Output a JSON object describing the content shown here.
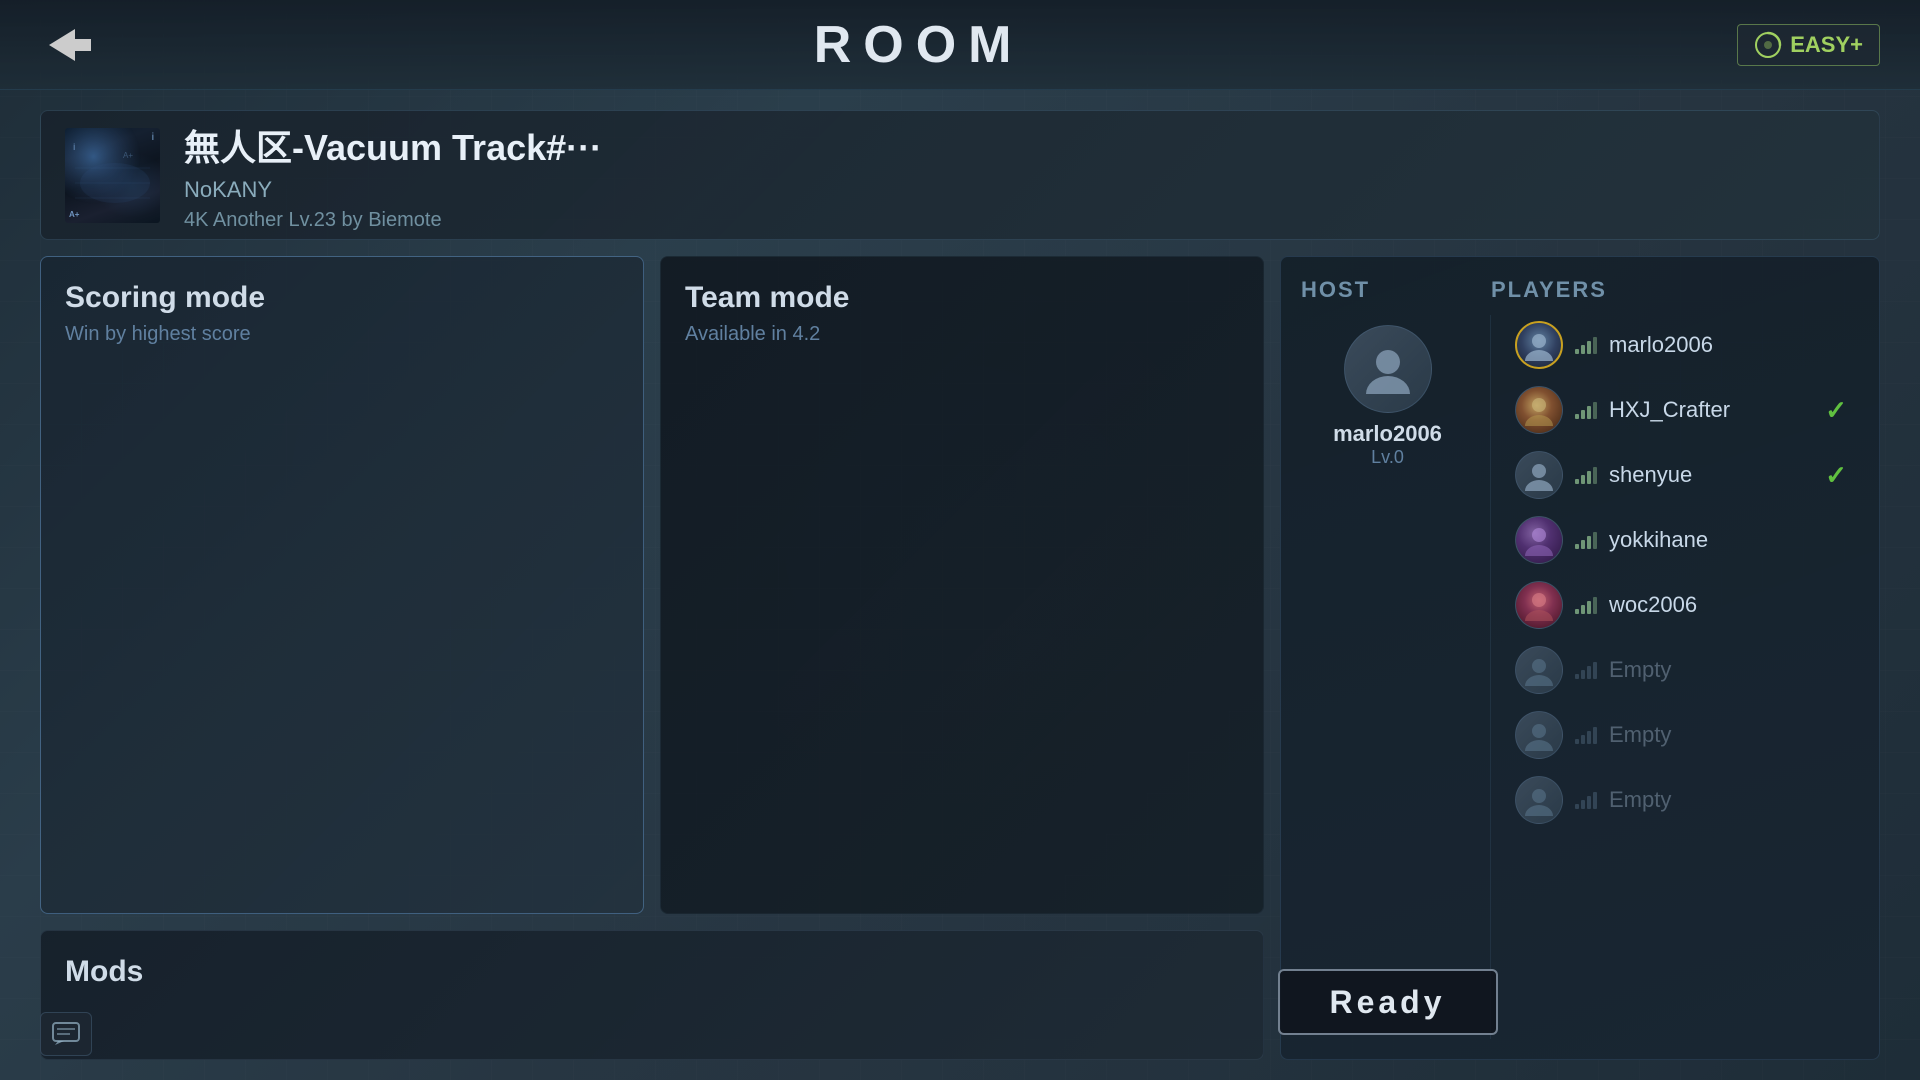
{
  "header": {
    "back_label": "←",
    "title": "ROOM",
    "difficulty": "EASY+"
  },
  "song": {
    "title": "無人区-Vacuum Track#···",
    "artist": "NoKANY",
    "details": "4K Another Lv.23 by Biemote"
  },
  "modes": {
    "scoring": {
      "title": "Scoring mode",
      "desc": "Win by highest score"
    },
    "team": {
      "title": "Team mode",
      "desc": "Available in 4.2"
    },
    "mods_label": "Mods"
  },
  "room": {
    "host_label": "HOST",
    "players_label": "PLAYERS",
    "host": {
      "name": "marlo2006",
      "level": "Lv.0"
    },
    "players": [
      {
        "name": "marlo2006",
        "status": "host",
        "checked": false
      },
      {
        "name": "HXJ_Crafter",
        "status": "active",
        "checked": true
      },
      {
        "name": "shenyue",
        "status": "active",
        "checked": true
      },
      {
        "name": "yokkihane",
        "status": "active",
        "checked": false
      },
      {
        "name": "woc2006",
        "status": "active",
        "checked": false
      },
      {
        "name": "Empty",
        "status": "empty",
        "checked": false
      },
      {
        "name": "Empty",
        "status": "empty",
        "checked": false
      },
      {
        "name": "Empty",
        "status": "empty",
        "checked": false
      }
    ],
    "ready_button": "Ready"
  },
  "chat": {
    "icon_label": "chat"
  }
}
